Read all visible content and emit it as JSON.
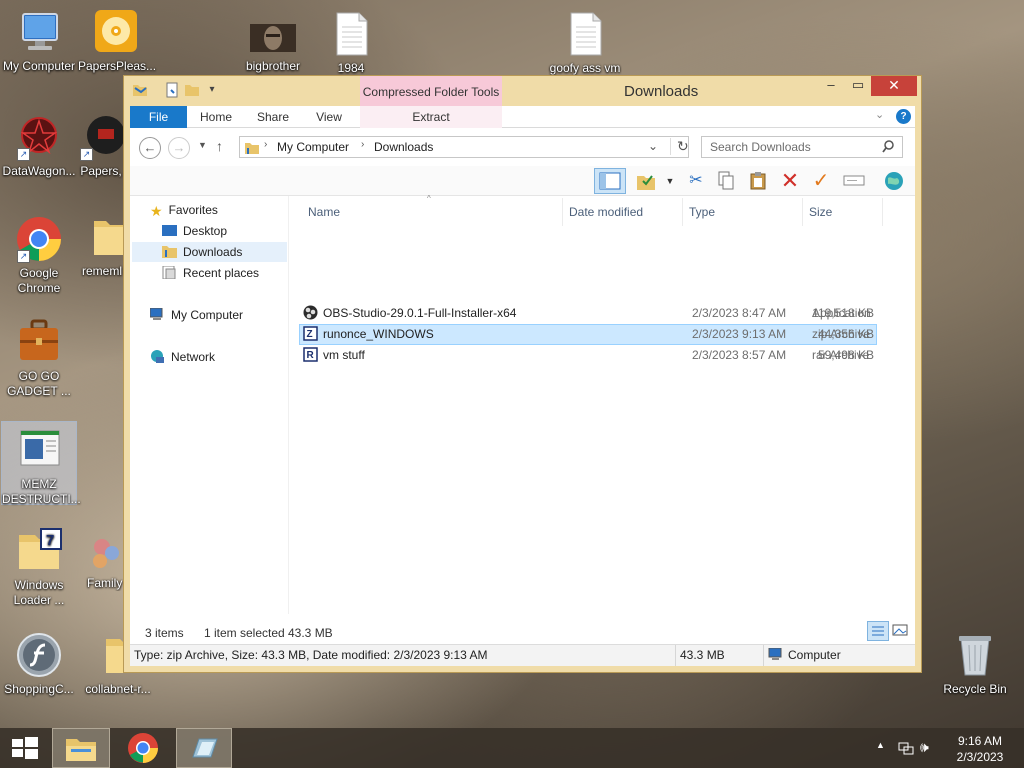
{
  "desktop": {
    "icons": [
      {
        "id": "my-computer",
        "label": "My Computer"
      },
      {
        "id": "papersplease",
        "label": "PapersPleas..."
      },
      {
        "id": "bigbrother",
        "label": "bigbrother"
      },
      {
        "id": "1984",
        "label": "1984"
      },
      {
        "id": "goofy-ass-vm",
        "label": "goofy ass vm"
      },
      {
        "id": "datawagon",
        "label": "DataWagon..."
      },
      {
        "id": "papers",
        "label": "Papers,"
      },
      {
        "id": "google-chrome",
        "label": "Google Chrome"
      },
      {
        "id": "remember",
        "label": "rememl"
      },
      {
        "id": "go-go-gadget",
        "label": "GO GO GADGET ..."
      },
      {
        "id": "memz",
        "label": "MEMZ DESTRUCTI..."
      },
      {
        "id": "windows-loader",
        "label": "Windows Loader ..."
      },
      {
        "id": "family",
        "label": "Family"
      },
      {
        "id": "shoppingc",
        "label": "ShoppingC..."
      },
      {
        "id": "collabnet",
        "label": "collabnet-r..."
      },
      {
        "id": "recycle-bin",
        "label": "Recycle Bin"
      }
    ]
  },
  "window": {
    "title": "Downloads",
    "context_tab": "Compressed Folder Tools",
    "context_sub": "Extract",
    "tabs": [
      "File",
      "Home",
      "Share",
      "View"
    ],
    "breadcrumb": [
      "My Computer",
      "Downloads"
    ],
    "search_placeholder": "Search Downloads",
    "nav": {
      "favorites": "Favorites",
      "desktop": "Desktop",
      "downloads": "Downloads",
      "recent": "Recent places",
      "computer": "My Computer",
      "network": "Network"
    },
    "columns": [
      "Name",
      "Date modified",
      "Type",
      "Size"
    ],
    "files": [
      {
        "name": "OBS-Studio-29.0.1-Full-Installer-x64",
        "date": "2/3/2023 8:47 AM",
        "type": "Application",
        "size": "119,518 KB"
      },
      {
        "name": "runonce_WINDOWS",
        "date": "2/3/2023 9:13 AM",
        "type": "zip Archive",
        "size": "44,356 KB"
      },
      {
        "name": "vm stuff",
        "date": "2/3/2023 8:57 AM",
        "type": "rar Archive",
        "size": "59,498 KB"
      }
    ],
    "status": {
      "items": "3 items",
      "selected": "1 item selected",
      "selected_size": "43.3 MB"
    },
    "details": {
      "info": "Type: zip Archive, Size: 43.3 MB, Date modified: 2/3/2023 9:13 AM",
      "size": "43.3 MB",
      "location": "Computer"
    }
  },
  "taskbar": {
    "time": "9:16 AM",
    "date": "2/3/2023"
  }
}
